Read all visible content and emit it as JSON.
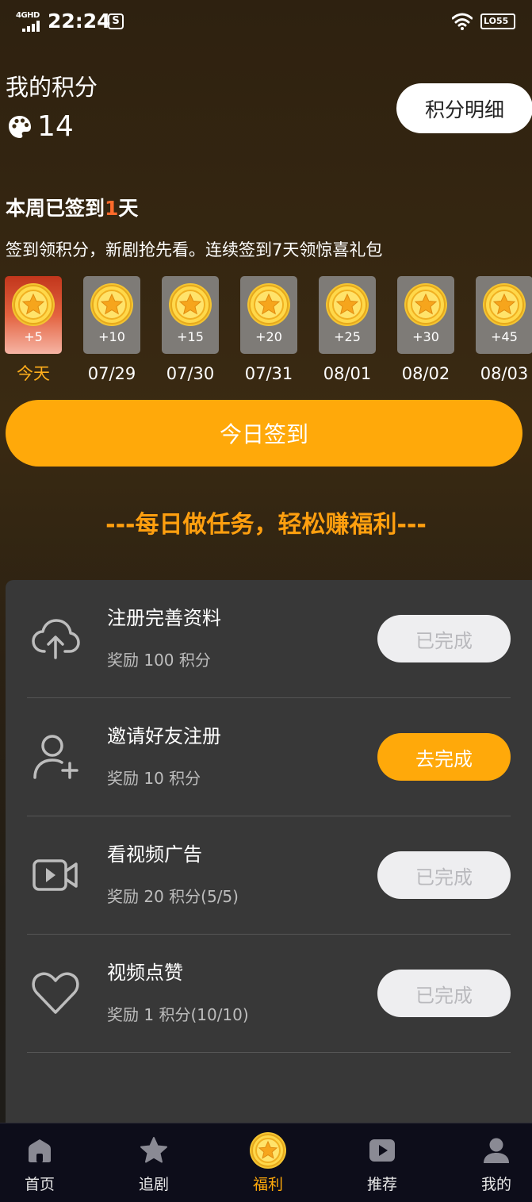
{
  "status_bar": {
    "network": "4GHD",
    "time": "22:24",
    "msg_icon": "S",
    "battery": "LO55"
  },
  "points": {
    "title": "我的积分",
    "value": "14",
    "detail_button": "积分明细"
  },
  "checkin": {
    "week_prefix": "本周已签到",
    "week_count": "1",
    "week_suffix": "天",
    "desc": "签到领积分，新剧抢先看。连续签到7天领惊喜礼包",
    "days": [
      {
        "points": "+5",
        "date": "今天",
        "today": true
      },
      {
        "points": "+10",
        "date": "07/29"
      },
      {
        "points": "+15",
        "date": "07/30"
      },
      {
        "points": "+20",
        "date": "07/31"
      },
      {
        "points": "+25",
        "date": "08/01"
      },
      {
        "points": "+30",
        "date": "08/02"
      },
      {
        "points": "+45",
        "date": "08/03"
      }
    ],
    "button": "今日签到"
  },
  "tasks": {
    "heading": "---每日做任务，轻松赚福利---",
    "items": [
      {
        "title": "注册完善资料",
        "reward": "奖励 100 积分",
        "button": "已完成",
        "icon": "cloud-upload-icon",
        "done": true
      },
      {
        "title": "邀请好友注册",
        "reward": "奖励 10 积分",
        "button": "去完成",
        "icon": "add-user-icon",
        "done": false
      },
      {
        "title": "看视频广告",
        "reward": "奖励 20 积分(5/5)",
        "button": "已完成",
        "icon": "video-icon",
        "done": true
      },
      {
        "title": "视频点赞",
        "reward": "奖励 1 积分(10/10)",
        "button": "已完成",
        "icon": "heart-icon",
        "done": true
      }
    ]
  },
  "tabs": [
    {
      "label": "首页",
      "icon": "home-icon"
    },
    {
      "label": "追剧",
      "icon": "star-icon"
    },
    {
      "label": "福利",
      "icon": "coin-icon",
      "active": true
    },
    {
      "label": "推荐",
      "icon": "play-icon"
    },
    {
      "label": "我的",
      "icon": "profile-icon"
    }
  ],
  "colors": {
    "accent": "#ffa90a",
    "highlight": "#ff6a2b",
    "panel": "#383838",
    "tabbar": "#0d0d1a"
  }
}
